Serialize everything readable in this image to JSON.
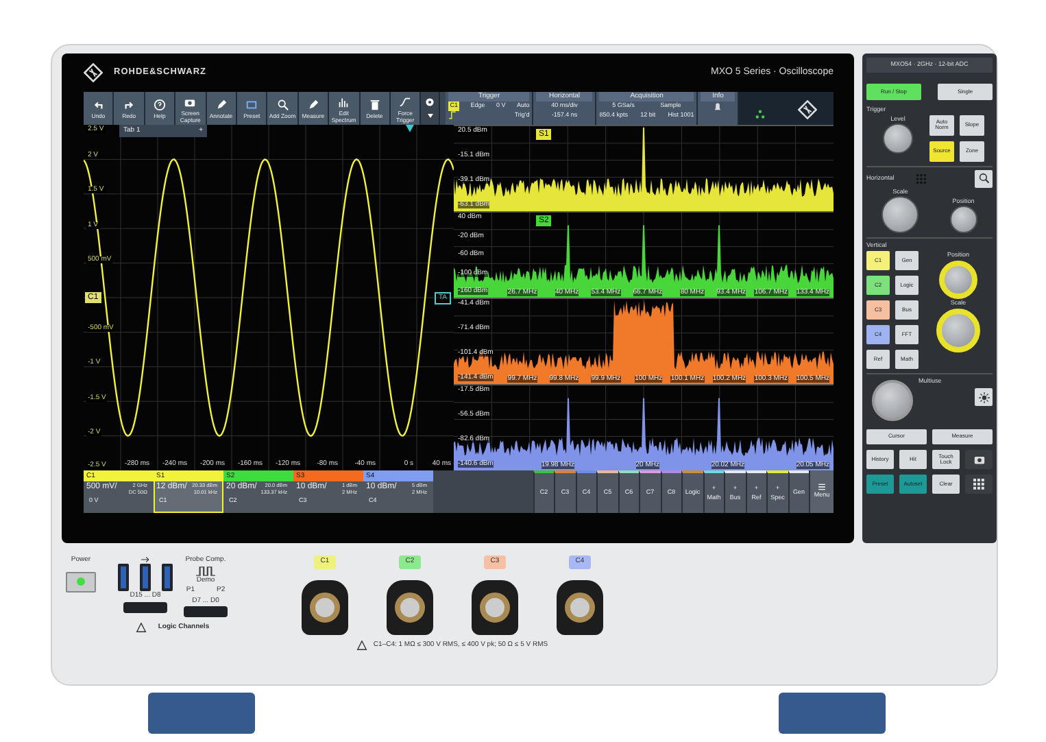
{
  "brand": "ROHDE&SCHWARZ",
  "screen_title": "MXO 5 Series · Oscilloscope",
  "toolbar": [
    {
      "label": "Undo"
    },
    {
      "label": "Redo"
    },
    {
      "label": "Help"
    },
    {
      "label": "Screen Capture"
    },
    {
      "label": "Annotate"
    },
    {
      "label": "Preset"
    },
    {
      "label": "Add Zoom"
    },
    {
      "label": "Measure"
    },
    {
      "label": "Edit Spectrum"
    },
    {
      "label": "Delete"
    },
    {
      "label": "Force Trigger"
    }
  ],
  "trigger": {
    "title": "Trigger",
    "source": "C1",
    "type": "Edge",
    "level": "0 V",
    "mode": "Auto",
    "state": "Trig'd"
  },
  "horizontal": {
    "title": "Horizontal",
    "scale": "40 ms/div",
    "position": "-157.4 ns"
  },
  "acquisition": {
    "title": "Acquisition",
    "rate": "5 GSa/s",
    "mode": "Sample",
    "points": "850.4 kpts",
    "resolution": "12 bit",
    "history": "Hist 1001"
  },
  "info": {
    "title": "Info"
  },
  "waveform": {
    "tab": "Tab 1",
    "tab_add": "+",
    "channel_marker": "C1",
    "trigger_marker": "TA",
    "y_labels": [
      "2.5 V",
      "2 V",
      "1.5 V",
      "1 V",
      "500 mV",
      "-500 mV",
      "-1 V",
      "-1.5 V",
      "-2 V",
      "-2.5 V"
    ],
    "x_labels": [
      "-280 ms",
      "-240 ms",
      "-200 ms",
      "-160 ms",
      "-120 ms",
      "-80 ms",
      "-40 ms",
      "0 s",
      "40 ms"
    ]
  },
  "spectra": [
    {
      "color": "#e6e63a",
      "kind": "tone",
      "marker": "S1",
      "y_labels": [
        "20.5 dBm",
        "-15.1 dBm",
        "-39.1 dBm",
        "-63.1 dBm"
      ]
    },
    {
      "color": "#49d63a",
      "kind": "tones",
      "marker": "S2",
      "y_labels": [
        "40 dBm",
        "-20 dBm",
        "-60 dBm",
        "-100 dBm",
        "-160 dBm"
      ],
      "x_labels": [
        "26.7 MHz",
        "40 MHz",
        "53.4 MHz",
        "66.7 MHz",
        "80 MHz",
        "93.4 MHz",
        "106.7 MHz",
        "133.4 MHz"
      ]
    },
    {
      "color": "#f07a2a",
      "kind": "band",
      "y_labels": [
        "-41.4 dBm",
        "-71.4 dBm",
        "-101.4 dBm",
        "-141.4 dBm"
      ],
      "x_labels": [
        "99.7 MHz",
        "99.8 MHz",
        "99.9 MHz",
        "100 MHz",
        "100.1 MHz",
        "100.2 MHz",
        "100.3 MHz",
        "100.5 MHz"
      ]
    },
    {
      "color": "#7f93e8",
      "kind": "tones",
      "y_labels": [
        "-17.5 dBm",
        "-56.5 dBm",
        "-82.6 dBm",
        "-140.6 dBm"
      ],
      "x_labels": [
        "19.98 MHz",
        "20 MHz",
        "20.02 MHz",
        "20.05 MHz"
      ]
    }
  ],
  "channels": [
    {
      "name": "C1",
      "color": "#f2f23a",
      "selected": false,
      "scale": "500 mV/",
      "detail_1": "2 GHz",
      "detail_2": "DC 50Ω",
      "source": "0 V"
    },
    {
      "name": "S1",
      "color": "#f2f23a",
      "selected": true,
      "scale": "12 dBm/",
      "detail_1": "20.33 dBm",
      "detail_2": "10.01 kHz",
      "source": "C1"
    },
    {
      "name": "S2",
      "color": "#3fdc3f",
      "selected": false,
      "scale": "20 dBm/",
      "detail_1": "20.0 dBm",
      "detail_2": "133.37 kHz",
      "source": "C2"
    },
    {
      "name": "S3",
      "color": "#f46a1e",
      "selected": false,
      "scale": "10 dBm/",
      "detail_1": "1 dBm",
      "detail_2": "2 MHz",
      "source": "C3"
    },
    {
      "name": "S4",
      "color": "#7f9ef0",
      "selected": false,
      "scale": "10 dBm/",
      "detail_1": "5 dBm",
      "detail_2": "2 MHz",
      "source": "C4"
    }
  ],
  "channel_buttons": [
    {
      "label": "C2",
      "color": "#3fbf3f"
    },
    {
      "label": "C3",
      "color": "#e0813a"
    },
    {
      "label": "C4",
      "color": "#6f8de0"
    },
    {
      "label": "C5",
      "color": "#e8b89a"
    },
    {
      "label": "C6",
      "color": "#8fe0c0"
    },
    {
      "label": "C7",
      "color": "#e09ad8"
    },
    {
      "label": "C8",
      "color": "#b08ae0"
    },
    {
      "label": "Logic",
      "color": "#c8903a"
    },
    {
      "label": "Math",
      "plus": "+",
      "color": "#6fd8e0"
    },
    {
      "label": "Bus",
      "plus": "+",
      "color": "#e8e8e8"
    },
    {
      "label": "Ref",
      "plus": "+",
      "color": "#e8e8e8"
    },
    {
      "label": "Spec",
      "plus": "+",
      "color": "#e8e83a"
    },
    {
      "label": "Gen",
      "color": "#e8e8e8"
    }
  ],
  "menu": "Menu",
  "panel": {
    "header": "MXO54 · 2GHz · 12-bit ADC",
    "run_stop": "Run / Stop",
    "single": "Single",
    "trigger": {
      "title": "Trigger",
      "knob": "Level",
      "buttons": [
        {
          "label": "Auto Norm",
          "lit": false
        },
        {
          "label": "Slope",
          "lit": false
        },
        {
          "label": "Source",
          "lit": true
        },
        {
          "label": "Zone",
          "lit": false
        }
      ]
    },
    "horizontal": {
      "title": "Horizontal",
      "knobs": [
        "Scale",
        "Position"
      ]
    },
    "vertical": {
      "title": "Vertical",
      "buttons": [
        {
          "label": "C1",
          "color": "#f5f07a"
        },
        {
          "label": "Gen"
        },
        {
          "label": "C2",
          "color": "#7de07d"
        },
        {
          "label": "Logic"
        },
        {
          "label": "C3",
          "color": "#f6bfa0"
        },
        {
          "label": "Bus"
        },
        {
          "label": "C4",
          "color": "#9fb2f2"
        },
        {
          "label": "FFT"
        },
        {
          "label": "Ref"
        },
        {
          "label": "Math"
        }
      ],
      "knobs": [
        "Position",
        "Scale"
      ]
    },
    "multi": {
      "title": "Multiuse"
    },
    "bottom_buttons": [
      {
        "label": "Cursor",
        "kind": "wide"
      },
      {
        "label": "Measure",
        "kind": "wide"
      },
      {
        "label": "History",
        "kind": "key"
      },
      {
        "label": "Hit",
        "kind": "key"
      },
      {
        "label": "Touch Lock",
        "kind": "key"
      },
      {
        "kind": "camera"
      },
      {
        "label": "Preset",
        "kind": "teal"
      },
      {
        "label": "Autoset",
        "kind": "teal"
      },
      {
        "label": "Clear",
        "kind": "key"
      },
      {
        "kind": "grid"
      }
    ]
  },
  "front": {
    "power": "Power",
    "probe_comp": "Probe Comp.",
    "demo": "Demo",
    "p1": "P1",
    "p2": "P2",
    "logic_ranges": [
      "D15 ... D8",
      "D7 ... D0"
    ],
    "logic_title": "Logic Channels",
    "inputs": [
      {
        "label": "C1",
        "color": "#eef27a"
      },
      {
        "label": "C2",
        "color": "#8ee88e"
      },
      {
        "label": "C3",
        "color": "#f6c0a4"
      },
      {
        "label": "C4",
        "color": "#a8b8f4"
      }
    ],
    "warning": "C1–C4: 1 MΩ ≤ 300 V RMS, ≤ 400 V pk; 50 Ω ≤ 5 V RMS"
  }
}
